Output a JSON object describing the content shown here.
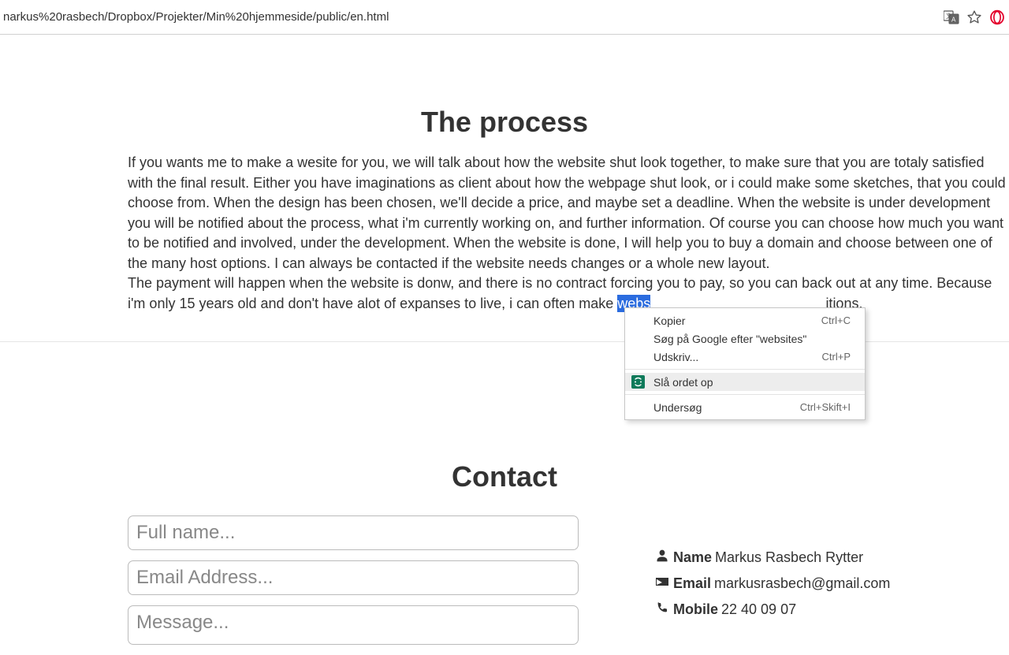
{
  "toolbar": {
    "url": "narkus%20rasbech/Dropbox/Projekter/Min%20hjemmeside/public/en.html"
  },
  "process": {
    "heading": "The process",
    "p1": "If you wants me to make a wesite for you, we will talk about how the website shut look together, to make sure that you are totaly satisfied with the final result. Either you have imaginations as client about how the webpage shut look, or i could make some sketches, that you could choose from. When the design has been chosen, we'll decide a price, and maybe set a deadline. When the website is under development you will be notified about the process, what i'm currently working on, and further information. Of course you can choose how much you want to be notified and involved, under the development. When the website is done, I will help you to buy a domain and choose between one of the many host options. I can always be contacted if the website needs changes or a whole new layout.",
    "p2a": "The payment will happen when the website is donw, and there is no contract forcing you to pay, so you can back out at any time. Because i'm only 15 years old and don't have alot of expanses to live, i can often make ",
    "p2_highlight": "webs",
    "p2b": "itions."
  },
  "contact": {
    "heading": "Contact",
    "placeholders": {
      "name": "Full name...",
      "email": "Email Address...",
      "message": "Message..."
    },
    "info": {
      "name_label": "Name",
      "name_value": "Markus Rasbech Rytter",
      "email_label": "Email",
      "email_value": "markusrasbech@gmail.com",
      "mobile_label": "Mobile",
      "mobile_value": "22 40 09 07"
    }
  },
  "context_menu": {
    "copy": {
      "label": "Kopier",
      "shortcut": "Ctrl+C"
    },
    "google": {
      "label": "Søg på Google efter \"websites\""
    },
    "print": {
      "label": "Udskriv...",
      "shortcut": "Ctrl+P"
    },
    "lookup": {
      "label": "Slå ordet op"
    },
    "inspect": {
      "label": "Undersøg",
      "shortcut": "Ctrl+Skift+I"
    }
  }
}
